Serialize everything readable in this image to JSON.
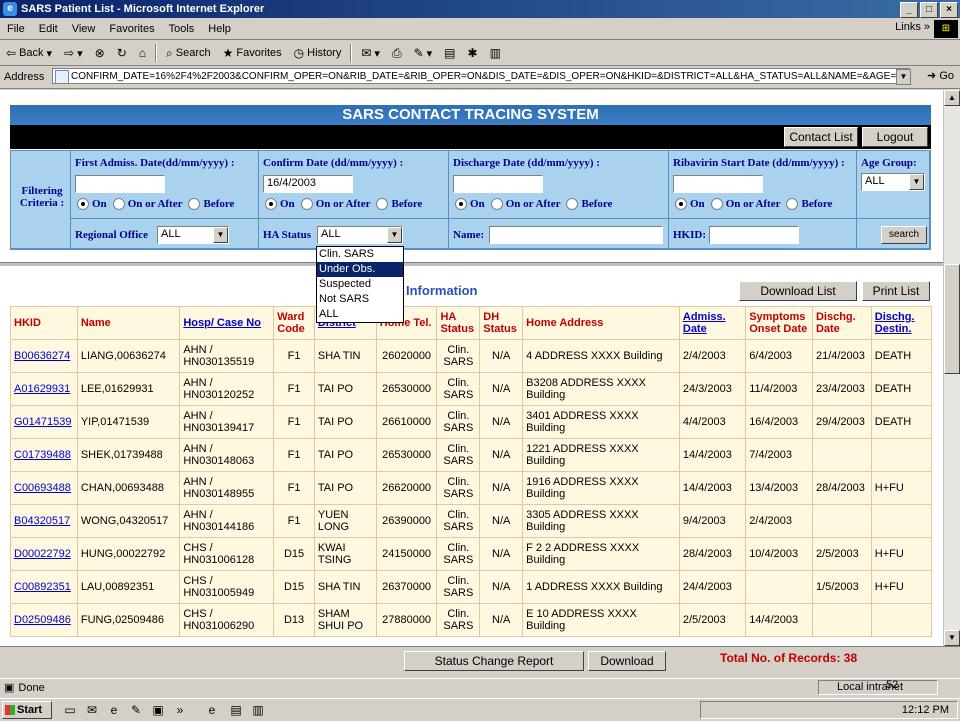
{
  "window": {
    "title": "SARS Patient List - Microsoft Internet Explorer",
    "buttons": [
      "_",
      "□",
      "×"
    ]
  },
  "menu": {
    "items": [
      "File",
      "Edit",
      "View",
      "Favorites",
      "Tools",
      "Help"
    ],
    "links": "Links »"
  },
  "toolbar": {
    "back": "Back",
    "search": "Search",
    "favorites": "Favorites",
    "history": "History"
  },
  "address": {
    "label": "Address",
    "value": "CONFIRM_DATE=16%2F4%2F2003&CONFIRM_OPER=ON&RIB_DATE=&RIB_OPER=ON&DIS_DATE=&DIS_OPER=ON&HKID=&DISTRICT=ALL&HA_STATUS=ALL&NAME=&AGE=ALL",
    "go": "Go"
  },
  "app": {
    "banner": "SARS CONTACT TRACING SYSTEM",
    "nav": {
      "contact_list": "Contact List",
      "logout": "Logout"
    }
  },
  "filter": {
    "section_label": "Filtering Criteria :",
    "first_admiss_label": "First Admiss. Date(dd/mm/yyyy) :",
    "first_admiss_value": "",
    "confirm_label": "Confirm Date (dd/mm/yyyy) :",
    "confirm_value": "16/4/2003",
    "discharge_label": "Discharge Date (dd/mm/yyyy) :",
    "discharge_value": "",
    "ribavirin_label": "Ribavirin Start Date (dd/mm/yyyy) :",
    "ribavirin_value": "",
    "age_label": "Age Group:",
    "age_value": "ALL",
    "radio_on": "On",
    "radio_after": "On or After",
    "radio_before": "Before",
    "region_label": "Regional Office",
    "region_value": "ALL",
    "ha_status_label": "HA Status",
    "ha_status_value": "ALL",
    "name_label": "Name:",
    "name_value": "",
    "hkid_label": "HKID:",
    "hkid_value": "",
    "search_button": "search"
  },
  "ha_status_options": [
    "Clin. SARS",
    "Under Obs.",
    "Suspected",
    "Not SARS",
    "ALL"
  ],
  "ha_status_highlighted": "Under Obs.",
  "list": {
    "title": "Information",
    "download_list": "Download List",
    "print_list": "Print List",
    "columns": [
      "HKID",
      "Name",
      "Hosp/ Case No",
      "Ward Code",
      "District",
      "Home Tel.",
      "HA Status",
      "DH Status",
      "Home Address",
      "Admiss. Date",
      "Symptoms Onset Date",
      "Dischg. Date",
      "Dischg. Destin."
    ],
    "rows": [
      [
        "B00636274",
        "LIANG,00636274",
        "AHN / HN030135519",
        "F1",
        "SHA TIN",
        "26020000",
        "Clin. SARS",
        "N/A",
        "4 ADDRESS XXXX Building",
        "2/4/2003",
        "6/4/2003",
        "21/4/2003",
        "DEATH"
      ],
      [
        "A01629931",
        "LEE,01629931",
        "AHN / HN030120252",
        "F1",
        "TAI PO",
        "26530000",
        "Clin. SARS",
        "N/A",
        "B3208 ADDRESS XXXX Building",
        "24/3/2003",
        "11/4/2003",
        "23/4/2003",
        "DEATH"
      ],
      [
        "G01471539",
        "YIP,01471539",
        "AHN / HN030139417",
        "F1",
        "TAI PO",
        "26610000",
        "Clin. SARS",
        "N/A",
        "3401 ADDRESS XXXX Building",
        "4/4/2003",
        "16/4/2003",
        "29/4/2003",
        "DEATH"
      ],
      [
        "C01739488",
        "SHEK,01739488",
        "AHN / HN030148063",
        "F1",
        "TAI PO",
        "26530000",
        "Clin. SARS",
        "N/A",
        "1221 ADDRESS XXXX Building",
        "14/4/2003",
        "7/4/2003",
        "",
        ""
      ],
      [
        "C00693488",
        "CHAN,00693488",
        "AHN / HN030148955",
        "F1",
        "TAI PO",
        "26620000",
        "Clin. SARS",
        "N/A",
        "1916 ADDRESS XXXX Building",
        "14/4/2003",
        "13/4/2003",
        "28/4/2003",
        "H+FU"
      ],
      [
        "B04320517",
        "WONG,04320517",
        "AHN / HN030144186",
        "F1",
        "YUEN LONG",
        "26390000",
        "Clin. SARS",
        "N/A",
        "3305 ADDRESS XXXX Building",
        "9/4/2003",
        "2/4/2003",
        "",
        ""
      ],
      [
        "D00022792",
        "HUNG,00022792",
        "CHS / HN031006128",
        "D15",
        "KWAI TSING",
        "24150000",
        "Clin. SARS",
        "N/A",
        "F 2 2 ADDRESS XXXX Building",
        "28/4/2003",
        "10/4/2003",
        "2/5/2003",
        "H+FU"
      ],
      [
        "C00892351",
        "LAU,00892351",
        "CHS / HN031005949",
        "D15",
        "SHA TIN",
        "26370000",
        "Clin. SARS",
        "N/A",
        "1 ADDRESS XXXX Building",
        "24/4/2003",
        "",
        "1/5/2003",
        "H+FU"
      ],
      [
        "D02509486",
        "FUNG,02509486",
        "CHS / HN031006290",
        "D13",
        "SHAM SHUI PO",
        "27880000",
        "Clin. SARS",
        "N/A",
        "E 10 ADDRESS XXXX Building",
        "2/5/2003",
        "14/4/2003",
        "",
        ""
      ]
    ]
  },
  "footer": {
    "status_change": "Status Change Report",
    "download": "Download",
    "total": "Total No. of Records: 38"
  },
  "statusbar": {
    "done": "Done",
    "zone": "Local intranet"
  },
  "slide_number": "52",
  "taskbar": {
    "start": "Start",
    "clock": "12:12 PM"
  }
}
